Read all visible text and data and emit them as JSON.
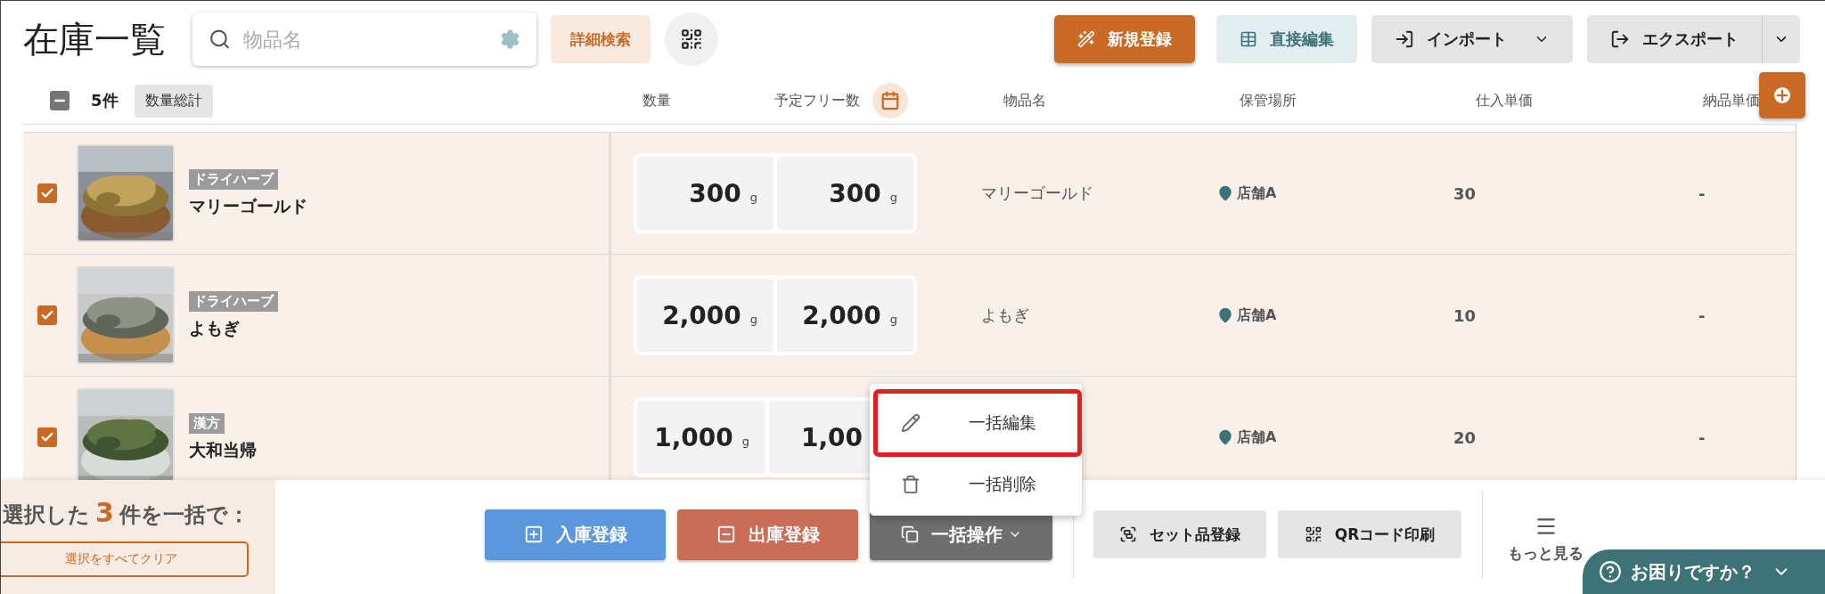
{
  "title": "在庫一覧",
  "search": {
    "placeholder": "物品名"
  },
  "advanced_search": "詳細検索",
  "actions": [
    {
      "label": "新規登録",
      "kind": "new"
    },
    {
      "label": "直接編集",
      "kind": "edit"
    },
    {
      "label": "インポート",
      "kind": "import"
    },
    {
      "label": "エクスポート",
      "kind": "export"
    }
  ],
  "summary": {
    "indeterminate": true,
    "count": "5件",
    "total_button": "数量総計"
  },
  "columns": [
    "数量",
    "予定フリー数",
    "物品名",
    "保管場所",
    "仕入単価",
    "納品単価"
  ],
  "rows": [
    {
      "checked": true,
      "tag": "ドライハーブ",
      "name": "マリーゴールド",
      "quantities": [
        {
          "value": "300",
          "unit": "g"
        },
        {
          "value": "300",
          "unit": "g"
        }
      ],
      "item_name": "マリーゴールド",
      "location": "店舗A",
      "cost": "30",
      "price": "-"
    },
    {
      "checked": true,
      "tag": "ドライハーブ",
      "name": "よもぎ",
      "quantities": [
        {
          "value": "2,000",
          "unit": "g"
        },
        {
          "value": "2,000",
          "unit": "g"
        }
      ],
      "item_name": "よもぎ",
      "location": "店舗A",
      "cost": "10",
      "price": "-"
    },
    {
      "checked": true,
      "tag": "漢方",
      "name": "大和当帰",
      "quantities": [
        {
          "value": "1,000",
          "unit": "g"
        },
        {
          "value": "1,00"
        }
      ],
      "location": "店舗A",
      "cost": "20",
      "price": "-"
    }
  ],
  "bulk": {
    "prefix": "選択した",
    "count": "3",
    "suffix": "件を一括で：",
    "clear_button": "選択をすべてクリア"
  },
  "bottom_actions": [
    {
      "label": "入庫登録",
      "kind": "inbound"
    },
    {
      "label": "出庫登録",
      "kind": "outbound"
    },
    {
      "label": "一括操作",
      "kind": "bulk"
    },
    {
      "label": "セット品登録",
      "kind": "set"
    },
    {
      "label": "QRコード印刷",
      "kind": "qr"
    }
  ],
  "more": "もっと見る",
  "menu": [
    {
      "label": "一括編集",
      "kind": "edit",
      "highlighted": true
    },
    {
      "label": "一括削除",
      "kind": "delete",
      "highlighted": false
    }
  ],
  "help": "お困りですか？"
}
